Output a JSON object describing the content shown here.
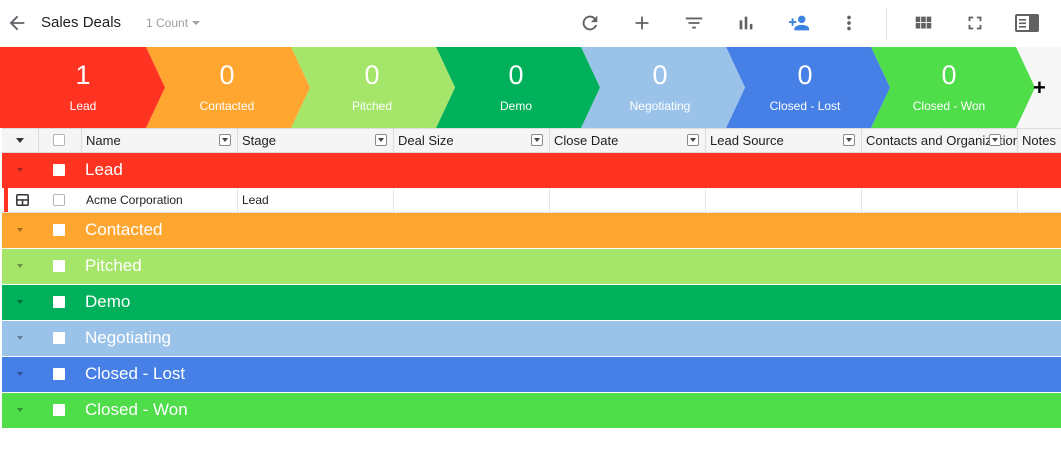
{
  "header": {
    "title": "Sales Deals",
    "count_label": "1 Count"
  },
  "pipeline": {
    "stages": [
      {
        "count": "1",
        "label": "Lead",
        "color": "#ff3322"
      },
      {
        "count": "0",
        "label": "Contacted",
        "color": "#ffa630"
      },
      {
        "count": "0",
        "label": "Pitched",
        "color": "#a5e56a"
      },
      {
        "count": "0",
        "label": "Demo",
        "color": "#00b05a"
      },
      {
        "count": "0",
        "label": "Negotiating",
        "color": "#9bc3ea"
      },
      {
        "count": "0",
        "label": "Closed - Lost",
        "color": "#4680e6"
      },
      {
        "count": "0",
        "label": "Closed - Won",
        "color": "#4fdd4a"
      }
    ],
    "add_label": "+"
  },
  "grid": {
    "columns": [
      "Name",
      "Stage",
      "Deal Size",
      "Close Date",
      "Lead Source",
      "Contacts and Organizations",
      "Notes"
    ],
    "groups": [
      "Lead",
      "Contacted",
      "Pitched",
      "Demo",
      "Negotiating",
      "Closed - Lost",
      "Closed - Won"
    ],
    "rows": [
      {
        "name": "Acme Corporation",
        "stage": "Lead",
        "deal_size": "",
        "close_date": "",
        "lead_source": "",
        "contacts": "",
        "notes": ""
      }
    ]
  },
  "icons": {
    "back": "arrow-left-icon",
    "refresh": "refresh-icon",
    "add": "plus-icon",
    "filter": "filter-icon",
    "chart": "bar-chart-icon",
    "add_user": "add-user-icon",
    "more": "more-vertical-icon",
    "grid_view": "grid-view-icon",
    "fullscreen": "fullscreen-icon",
    "panel": "side-panel-icon"
  },
  "colors": {
    "accent_blue": "#3b82e0"
  }
}
